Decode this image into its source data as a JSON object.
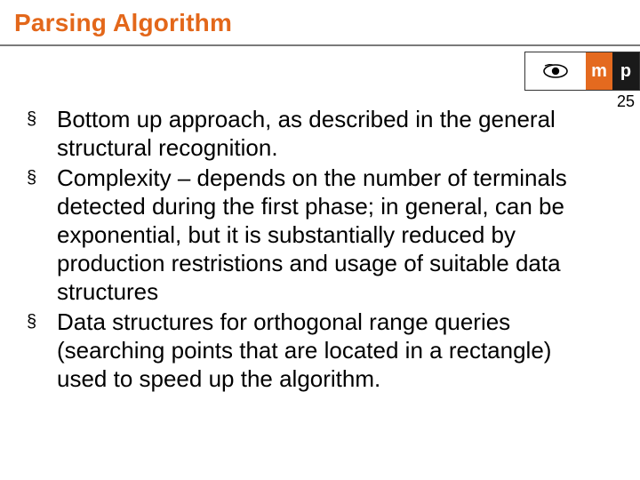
{
  "slide": {
    "title": "Parsing Algorithm",
    "page_number": "25",
    "logo": {
      "letter1": "m",
      "letter2": "p"
    },
    "bullets": [
      "Bottom up approach, as described in the general structural recognition.",
      "Complexity – depends on the number of terminals detected during the first phase; in general, can be exponential, but it is substantially reduced by production restristions and usage of suitable data structures",
      "Data structures for orthogonal range queries (searching points that are located in a rectangle) used to speed up the algorithm."
    ]
  }
}
